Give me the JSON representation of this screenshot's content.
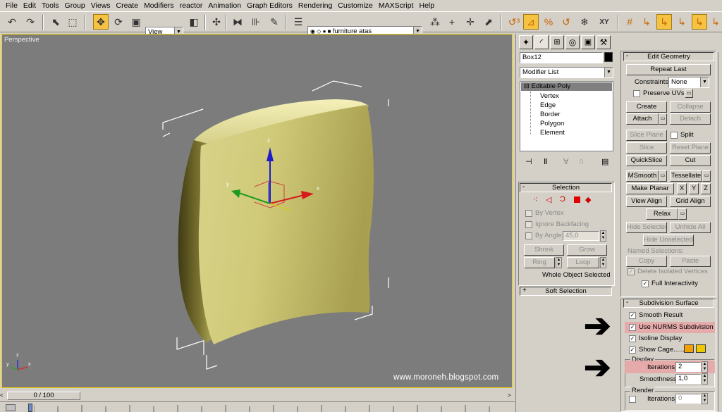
{
  "menu": [
    "File",
    "Edit",
    "Tools",
    "Group",
    "Views",
    "Create",
    "Modifiers",
    "reactor",
    "Animation",
    "Graph Editors",
    "Rendering",
    "Customize",
    "MAXScript",
    "Help"
  ],
  "toolbar": {
    "view_select": "View",
    "layer_name": "furniture atas"
  },
  "viewport": {
    "label": "Perspective",
    "watermark": "www.moroneh.blogspot.com",
    "axis_x": "x",
    "axis_y": "y",
    "axis_z": "z",
    "mini_axis_x": "x",
    "mini_axis_y": "y",
    "mini_axis_z": "z",
    "object_color": "#d6d28a"
  },
  "timeline": {
    "frame_label": "0 / 100"
  },
  "modify": {
    "object_name": "Box12",
    "object_color": "#000000",
    "modifier_list_label": "Modifier List",
    "stack": {
      "root": "Editable Poly",
      "children": [
        "Vertex",
        "Edge",
        "Border",
        "Polygon",
        "Element"
      ]
    }
  },
  "selection": {
    "title": "Selection",
    "by_vertex": "By Vertex",
    "ignore_backfacing": "Ignore Backfacing",
    "by_angle": "By Angle:",
    "angle_value": "45,0",
    "shrink": "Shrink",
    "grow": "Grow",
    "ring": "Ring",
    "loop": "Loop",
    "status": "Whole Object Selected"
  },
  "soft_selection": {
    "title": "Soft Selection"
  },
  "edit_geometry": {
    "title": "Edit Geometry",
    "repeat_last": "Repeat Last",
    "constraints_label": "Constraints:",
    "constraints_value": "None",
    "preserve_uvs": "Preserve UVs",
    "create": "Create",
    "collapse": "Collapse",
    "attach": "Attach",
    "detach": "Detach",
    "slice_plane": "Slice Plane",
    "split": "Split",
    "slice": "Slice",
    "reset_plane": "Reset Plane",
    "quickslice": "QuickSlice",
    "cut": "Cut",
    "msmooth": "MSmooth",
    "tessellate": "Tessellate",
    "make_planar": "Make Planar",
    "x": "X",
    "y": "Y",
    "z": "Z",
    "view_align": "View Align",
    "grid_align": "Grid Align",
    "relax": "Relax",
    "hide_selected": "Hide Selected",
    "unhide_all": "Unhide All",
    "hide_unselected": "Hide Unselected",
    "named_selections": "Named Selections:",
    "copy": "Copy",
    "paste": "Paste",
    "delete_isolated": "Delete Isolated Vertices",
    "full_interactivity": "Full Interactivity"
  },
  "subdivision": {
    "title": "Subdivision Surface",
    "smooth_result": "Smooth Result",
    "use_nurms": "Use NURMS Subdivision",
    "isoline_display": "Isoline Display",
    "show_cage": "Show Cage......",
    "cage_color_1": "#f0a000",
    "cage_color_2": "#f0c800",
    "display_group": "Display",
    "iterations_label": "Iterations:",
    "iterations_value": "2",
    "smoothness_label": "Smoothness:",
    "smoothness_value": "1,0",
    "render_group": "Render",
    "render_iterations_label": "Iterations:",
    "render_iterations_value": "0"
  },
  "colors": {
    "highlight": "#e8a4a4",
    "active_tool": "#f5c242",
    "viewport_bg": "#7c7c7c"
  }
}
